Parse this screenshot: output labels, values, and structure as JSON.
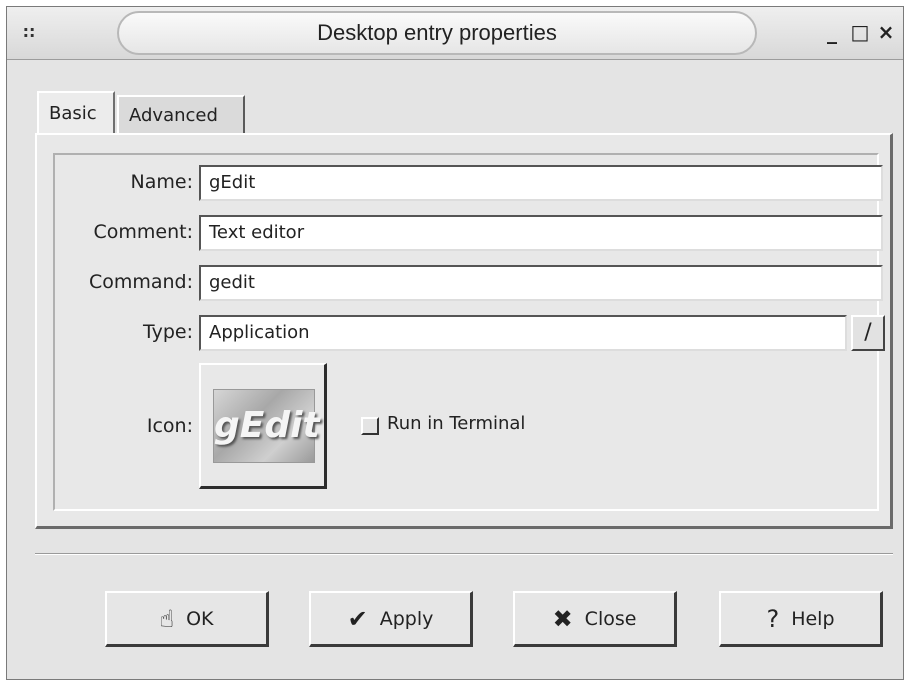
{
  "window": {
    "title": "Desktop entry properties",
    "menu_glyph": "::",
    "minimize_glyph": "_",
    "maximize_glyph": "□",
    "close_glyph": "×"
  },
  "tabs": [
    {
      "label": "Basic",
      "active": true
    },
    {
      "label": "Advanced",
      "active": false
    }
  ],
  "form": {
    "name_label": "Name:",
    "name_value": "gEdit",
    "comment_label": "Comment:",
    "comment_value": "Text editor",
    "command_label": "Command:",
    "command_value": "gedit",
    "type_label": "Type:",
    "type_value": "Application",
    "type_browse_glyph": "/",
    "icon_label": "Icon:",
    "icon_text": "gEdit",
    "run_in_terminal_label": "Run in Terminal",
    "run_in_terminal_checked": false
  },
  "buttons": {
    "ok": {
      "label": "OK",
      "icon": "hand-icon",
      "glyph": "☝"
    },
    "apply": {
      "label": "Apply",
      "icon": "checkmark-icon",
      "glyph": "✔"
    },
    "close": {
      "label": "Close",
      "icon": "x-icon",
      "glyph": "✖"
    },
    "help": {
      "label": "Help",
      "icon": "question-icon",
      "glyph": "?"
    }
  },
  "colors": {
    "window_bg": "#e4e4e4",
    "field_bg": "#ffffff"
  }
}
